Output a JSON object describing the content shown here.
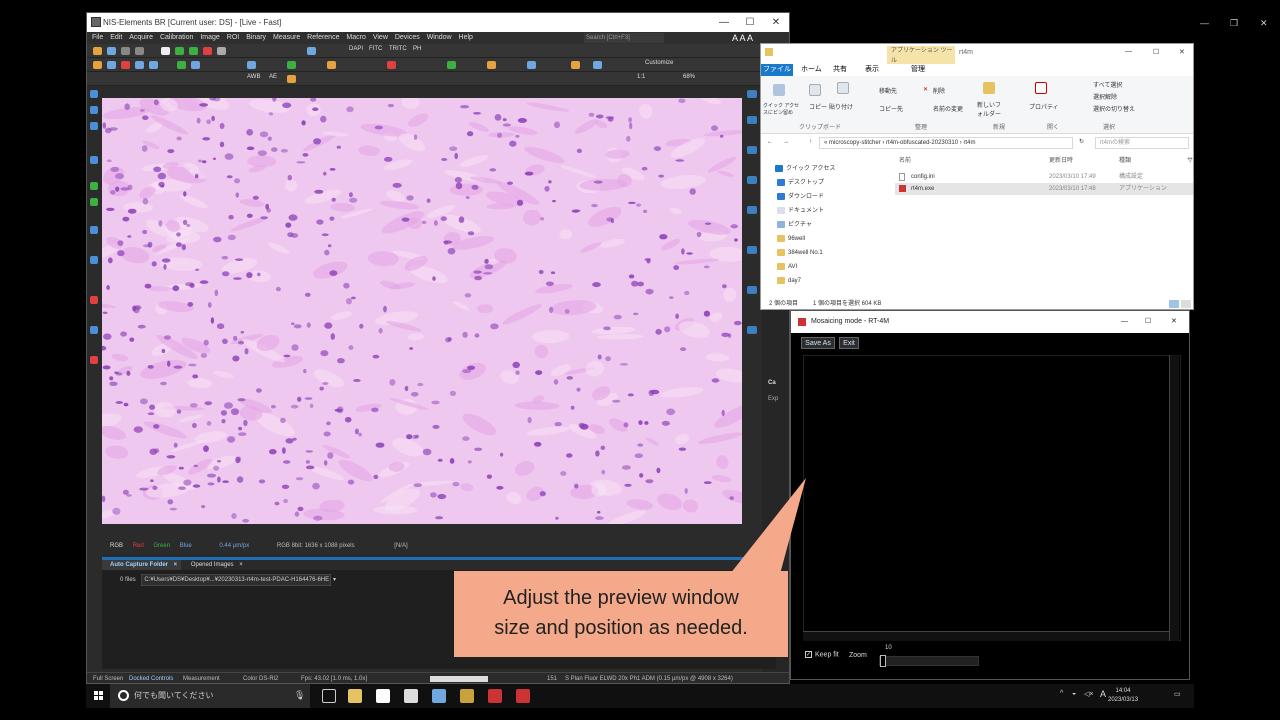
{
  "nis": {
    "title": "NIS-Elements BR [Current user: DS]  - [Live - Fast]",
    "menu": [
      "File",
      "Edit",
      "Acquire",
      "Calibration",
      "Image",
      "ROI",
      "Binary",
      "Measure",
      "Reference",
      "Macro",
      "View",
      "Devices",
      "Window",
      "Help"
    ],
    "search_placeholder": "Search [Ctrl+F3]",
    "toolbar1_labels": [
      "DAPI",
      "FITC",
      "TRITC",
      "PH"
    ],
    "customize_label": "Customize",
    "toolbar3_labels": [
      "AWB",
      "AE"
    ],
    "ratio_label": "1:1",
    "zoom_percent": "68%",
    "image_status": {
      "channels": [
        "RGB",
        "Red",
        "Green",
        "Blue"
      ],
      "scale": "0.44 µm/px",
      "format": "RGB 8bit: 1636 x 1088 pixels",
      "value": "[N/A]"
    },
    "capture_panel": {
      "tabs": [
        "Auto Capture Folder",
        "Opened Images"
      ],
      "files_count": "0 files",
      "path": "C:¥Users¥DS¥Desktop¥...¥20230313-rt4m-test-PDAC-H164476-6HE"
    },
    "status_bar": {
      "tabs": [
        "Full Screen",
        "Docked Controls",
        "Measurement"
      ],
      "camera": "Color DS-Ri2",
      "fps": "Fps: 43.02 [1.0 ms, 1.0x]",
      "frame": "151",
      "objective": "S Plan Fluor ELWD 20x Ph1 ADM (0.15 µm/px @ 4908 x 3264)"
    },
    "right_panel_labels": [
      "Ca",
      "Exp"
    ]
  },
  "explorer": {
    "context_tab": "アプリケーション ツール",
    "title": "rt4m",
    "manage_tab": "管理",
    "tabs": [
      "ファイル",
      "ホーム",
      "共有",
      "表示"
    ],
    "ribbon": {
      "pin_label": "クイック アクセスにピン留め",
      "copy": "コピー",
      "paste": "貼り付け",
      "clipboard_group": "クリップボード",
      "move_to": "移動先",
      "copy_to": "コピー先",
      "delete": "削除",
      "rename": "名前の変更",
      "organize_group": "整理",
      "new_folder": "新しいフォルダー",
      "new_group": "新規",
      "properties": "プロパティ",
      "open_group": "開く",
      "select_all": "すべて選択",
      "select_none": "選択解除",
      "invert_selection": "選択の切り替え",
      "select_group": "選択"
    },
    "address": [
      "microscopy-stitcher",
      "rt4m-obfuscated-20230310",
      "rt4m"
    ],
    "search_placeholder": "rt4mの検索",
    "nav": [
      "クイック アクセス",
      "デスクトップ",
      "ダウンロード",
      "ドキュメント",
      "ピクチャ",
      "96well",
      "384well No.1",
      "AVI",
      "day7"
    ],
    "columns": [
      "名前",
      "更新日時",
      "種類",
      "サ"
    ],
    "files": [
      {
        "name": "config.ini",
        "date": "2023/03/10 17:49",
        "type": "構成設定"
      },
      {
        "name": "rt4m.exe",
        "date": "2023/03/10 17:48",
        "type": "アプリケーション"
      }
    ],
    "status_items": "2 個の項目",
    "status_selected": "1 個の項目を選択  604 KB"
  },
  "mosaic": {
    "title": "Mosaicing mode - RT-4M",
    "save_as": "Save As",
    "exit": "Exit",
    "keep_fit": "Keep fit",
    "zoom_label": "Zoom",
    "zoom_value": "10"
  },
  "callout": {
    "line1": "Adjust the preview window",
    "line2": "size and position as needed."
  },
  "taskbar": {
    "search_placeholder": "何でも聞いてください",
    "time": "14:04",
    "date": "2023/03/13",
    "ime": "A"
  },
  "colors": {
    "tissue_bg": "#efc8ef",
    "tissue_nucleus": "#8a3fb8",
    "callout": "#f4a98a",
    "explorer_accent": "#1979ca"
  }
}
